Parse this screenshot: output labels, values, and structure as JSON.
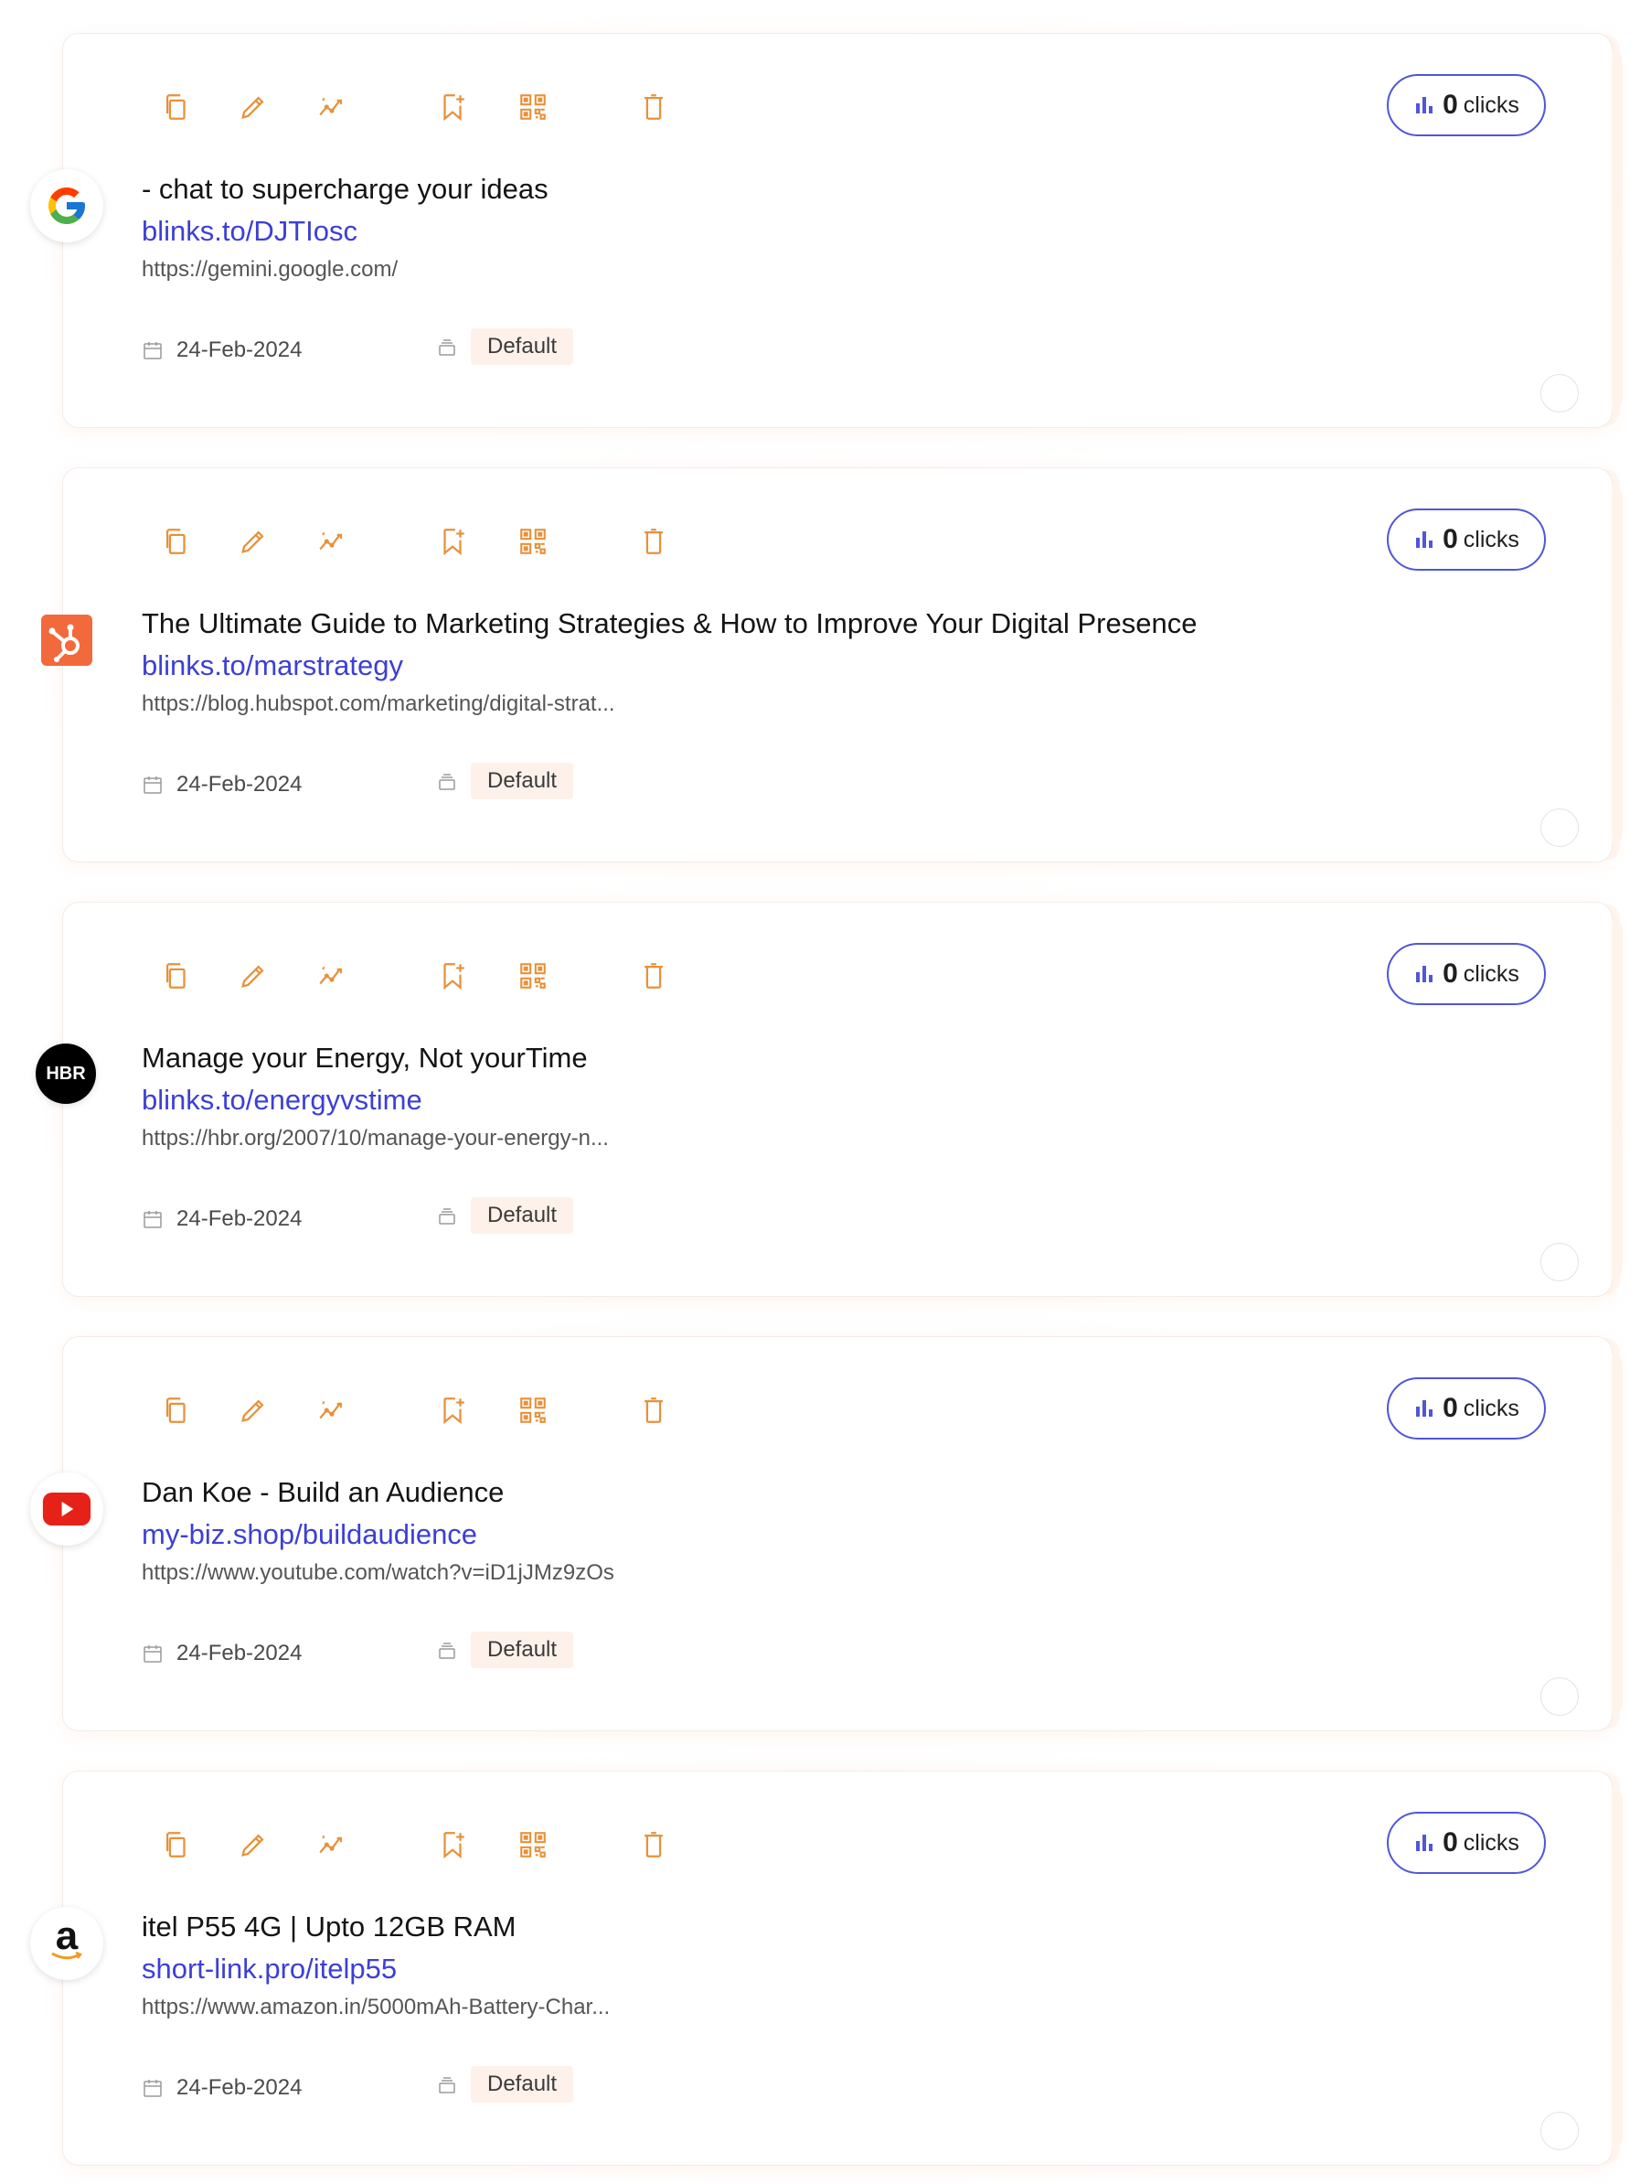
{
  "accent_color": "#e8913a",
  "link_color": "#3d3fd6",
  "clicks_label": "clicks",
  "links": [
    {
      "favicon": "google-icon",
      "title": " - chat to supercharge your ideas",
      "short_url": "blinks.to/DJTIosc",
      "long_url": "https://gemini.google.com/",
      "clicks": "0",
      "date": "24-Feb-2024",
      "category": "Default"
    },
    {
      "favicon": "hubspot-icon",
      "title": "The Ultimate Guide to Marketing Strategies & How to Improve Your Digital Presence",
      "short_url": "blinks.to/marstrategy",
      "long_url": "https://blog.hubspot.com/marketing/digital-strat...",
      "clicks": "0",
      "date": "24-Feb-2024",
      "category": "Default"
    },
    {
      "favicon": "hbr-icon",
      "favicon_text": "HBR",
      "title": "Manage your Energy, Not yourTime",
      "short_url": "blinks.to/energyvstime",
      "long_url": "https://hbr.org/2007/10/manage-your-energy-n...",
      "clicks": "0",
      "date": "24-Feb-2024",
      "category": "Default"
    },
    {
      "favicon": "youtube-icon",
      "title": "Dan Koe - Build an Audience",
      "short_url": "my-biz.shop/buildaudience",
      "long_url": "https://www.youtube.com/watch?v=iD1jJMz9zOs",
      "clicks": "0",
      "date": "24-Feb-2024",
      "category": "Default"
    },
    {
      "favicon": "amazon-icon",
      "favicon_text": "a",
      "title": "itel P55 4G | Upto 12GB RAM",
      "short_url": "short-link.pro/itelp55",
      "long_url": "https://www.amazon.in/5000mAh-Battery-Char...",
      "clicks": "0",
      "date": "24-Feb-2024",
      "category": "Default"
    }
  ]
}
